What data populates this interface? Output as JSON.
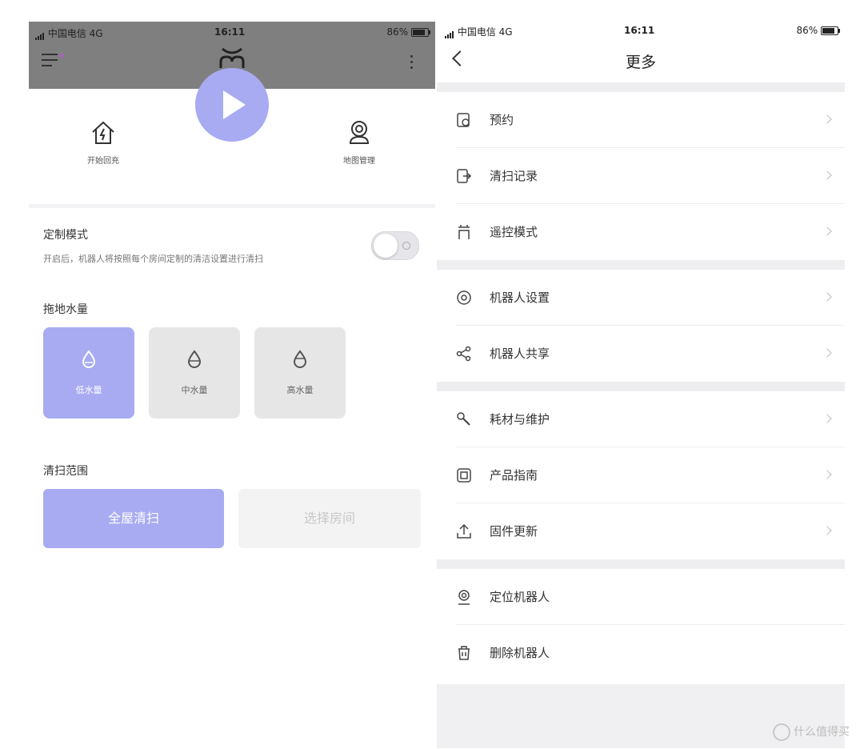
{
  "left": {
    "status": {
      "carrier": "中国电信 4G",
      "time": "16:11",
      "battery": "86%"
    },
    "quick_actions": {
      "recharge": "开始回充",
      "map": "地图管理"
    },
    "custom_mode": {
      "title": "定制模式",
      "desc": "开启后，机器人将按照每个房间定制的清洁设置进行清扫",
      "enabled": false
    },
    "water": {
      "title": "拖地水量",
      "options": [
        "低水量",
        "中水量",
        "高水量"
      ],
      "selected": "低水量"
    },
    "range": {
      "title": "清扫范围",
      "whole": "全屋清扫",
      "select": "选择房间",
      "selected": "全屋清扫"
    }
  },
  "right": {
    "status": {
      "carrier": "中国电信 4G",
      "time": "16:11",
      "battery": "86%"
    },
    "nav_title": "更多",
    "groups": [
      [
        "预约",
        "清扫记录",
        "遥控模式"
      ],
      [
        "机器人设置",
        "机器人共享"
      ],
      [
        "耗材与维护",
        "产品指南",
        "固件更新"
      ],
      [
        "定位机器人",
        "删除机器人"
      ]
    ]
  },
  "watermark": "什么值得买",
  "colors": {
    "accent": "#a8abf2",
    "header_gray": "#7f7f7f"
  }
}
